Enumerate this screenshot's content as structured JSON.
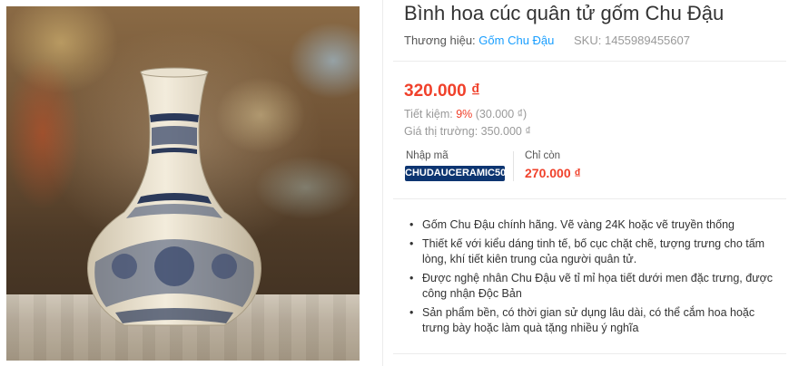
{
  "product": {
    "title": "Bình hoa cúc quân tử gốm Chu Đậu",
    "brand_label": "Thương hiệu:",
    "brand_name": "Gốm Chu Đậu",
    "sku_label": "SKU:",
    "sku": "1455989455607"
  },
  "pricing": {
    "price": "320.000 ₫",
    "save_label": "Tiết kiệm:",
    "save_percent": "9%",
    "save_amount": "(30.000 ₫)",
    "market_label": "Giá thị trường:",
    "market_price": "350.000 ₫"
  },
  "coupon": {
    "code_label": "Nhập mã",
    "code": "CHUDAUCERAMIC50",
    "only_label": "Chỉ còn",
    "final_price": "270.000 ₫"
  },
  "features": [
    "Gốm Chu Đậu chính hãng. Vẽ vàng 24K hoặc vẽ truyền thống",
    "Thiết kế với kiểu dáng tinh tế, bố cục chặt chẽ, tượng trưng cho tấm lòng, khí tiết kiên trung của người quân tử.",
    "Được nghệ nhân Chu Đậu vẽ tỉ mỉ họa tiết dưới men đặc trưng, được công nhận Độc Bản",
    "Sản phẩm bền, có thời gian sử dụng lâu dài, có thể cắm hoa hoặc trưng bày hoặc làm quà tặng nhiều ý nghĩa"
  ],
  "colors": {
    "price_red": "#f0412b",
    "link_blue": "#189eff",
    "badge_navy": "#0d3571"
  }
}
